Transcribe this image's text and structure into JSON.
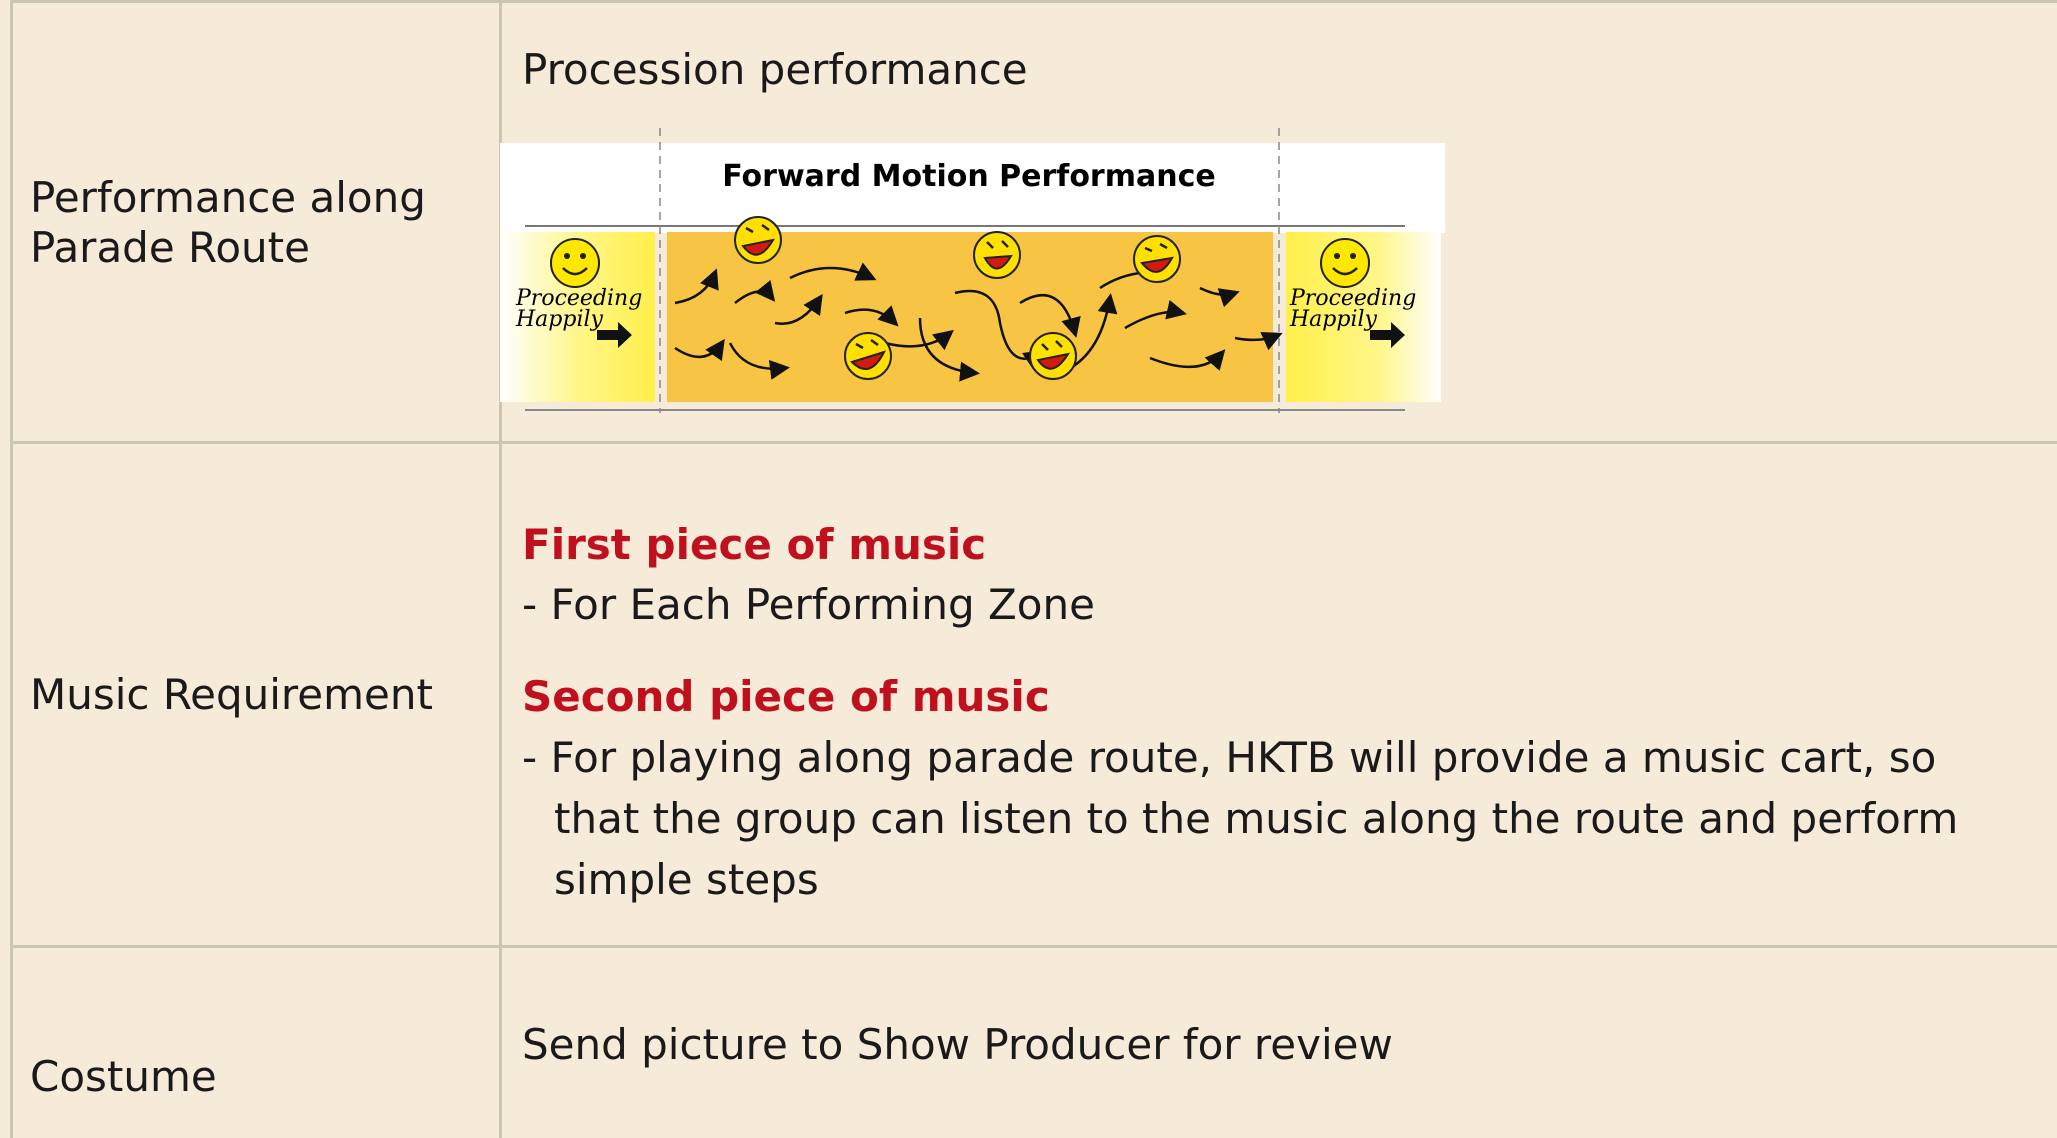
{
  "rows": [
    {
      "label": [
        "Performance along",
        "Parade Route"
      ],
      "content_heading": "Procession performance",
      "figure": {
        "title": "Forward Motion Performance",
        "left_label": [
          "Proceeding",
          "Happily"
        ],
        "right_label": [
          "Proceeding",
          "Happily"
        ]
      }
    },
    {
      "label": [
        "Music Requirement"
      ],
      "first_heading": "First piece of music",
      "first_detail": "- For Each Performing Zone",
      "second_heading": "Second piece of music",
      "second_detail": [
        "- For playing along parade route, HKTB will provide a music cart, so",
        "that the group can listen to the music along the route and perform",
        "simple steps"
      ]
    },
    {
      "label": [
        "Costume"
      ],
      "content": "Send picture to Show Producer for review"
    }
  ],
  "colors": {
    "background": "#f6ead8",
    "border": "#cbc7ae",
    "accent_red": "#c0101e",
    "stage_yellow": "#f7c443",
    "side_yellow": "#fff36b"
  },
  "icons": [
    "smiley-icon",
    "laughing-face-icon",
    "arrow-right-icon"
  ]
}
